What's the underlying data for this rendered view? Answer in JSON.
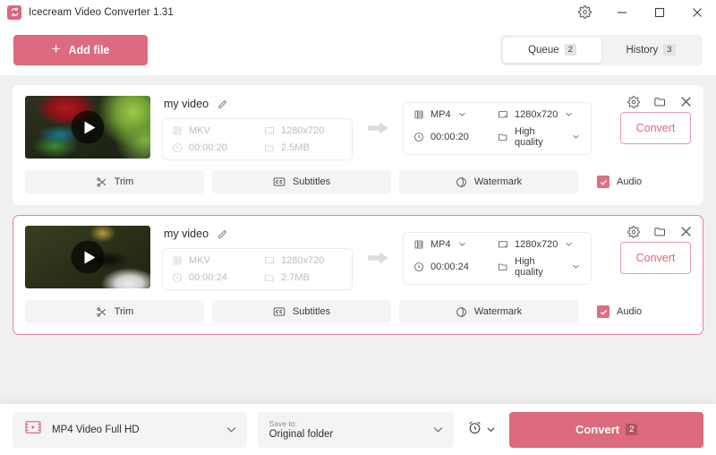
{
  "titlebar": {
    "app_name": "Icecream Video Converter 1.31",
    "icon": "convert-arrows-icon",
    "settings_icon": "gear-icon",
    "minimize_icon": "minimize-icon",
    "maximize_icon": "maximize-icon",
    "close_icon": "close-icon"
  },
  "header": {
    "add_file_label": "Add file",
    "add_file_icon": "plus-icon",
    "tabs": [
      {
        "label": "Queue",
        "badge": "2",
        "active": true
      },
      {
        "label": "History",
        "badge": "3",
        "active": false
      }
    ]
  },
  "colors": {
    "accent": "#dd6a7e",
    "accent_border": "#e79bab",
    "selected_card_border": "#e8809a",
    "content_bg": "#f0f0f0",
    "chip_bg": "#f4f4f4"
  },
  "cards": [
    {
      "selected": false,
      "thumb_alt": "parrot-video-thumbnail",
      "file_name": "my video",
      "edit_icon": "pencil-icon",
      "source": {
        "format": "MKV",
        "format_icon": "film-icon",
        "resolution": "1280x720",
        "resolution_icon": "monitor-icon",
        "duration": "00:00:20",
        "duration_icon": "clock-icon",
        "size": "2.5MB",
        "size_icon": "folder-icon"
      },
      "output": {
        "format": "MP4",
        "format_icon": "film-icon",
        "resolution": "1280x720",
        "resolution_icon": "monitor-icon",
        "duration": "00:00:20",
        "duration_icon": "clock-icon",
        "quality": "High quality",
        "quality_icon": "folder-icon"
      },
      "convert_label": "Convert",
      "actions": {
        "trim": "Trim",
        "trim_icon": "scissors-icon",
        "subtitles": "Subtitles",
        "subtitles_icon": "cc-icon",
        "watermark": "Watermark",
        "watermark_icon": "watermark-icon",
        "audio": "Audio",
        "audio_checked": true
      },
      "icons": {
        "settings": "gear-icon",
        "folder": "folder-open-icon",
        "remove": "close-icon"
      }
    },
    {
      "selected": true,
      "thumb_alt": "bird-video-thumbnail",
      "file_name": "my video",
      "edit_icon": "pencil-icon",
      "source": {
        "format": "MKV",
        "format_icon": "film-icon",
        "resolution": "1280x720",
        "resolution_icon": "monitor-icon",
        "duration": "00:00:24",
        "duration_icon": "clock-icon",
        "size": "2.7MB",
        "size_icon": "folder-icon"
      },
      "output": {
        "format": "MP4",
        "format_icon": "film-icon",
        "resolution": "1280x720",
        "resolution_icon": "monitor-icon",
        "duration": "00:00:24",
        "duration_icon": "clock-icon",
        "quality": "High quality",
        "quality_icon": "folder-icon"
      },
      "convert_label": "Convert",
      "actions": {
        "trim": "Trim",
        "trim_icon": "scissors-icon",
        "subtitles": "Subtitles",
        "subtitles_icon": "cc-icon",
        "watermark": "Watermark",
        "watermark_icon": "watermark-icon",
        "audio": "Audio",
        "audio_checked": true
      },
      "icons": {
        "settings": "gear-icon",
        "folder": "folder-open-icon",
        "remove": "close-icon"
      }
    }
  ],
  "footer": {
    "preset_label": "MP4 Video Full HD",
    "preset_icon": "video-preset-icon",
    "save_to_caption": "Save to:",
    "save_to_value": "Original folder",
    "timer_icon": "alarm-clock-icon",
    "convert_label": "Convert",
    "convert_badge": "2"
  }
}
